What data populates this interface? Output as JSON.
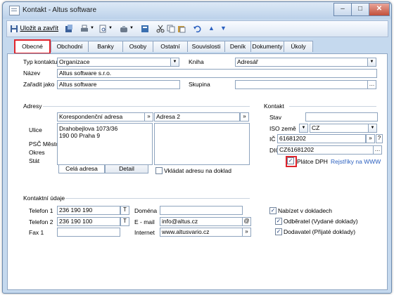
{
  "window": {
    "title": "Kontakt - Altus software",
    "min_glyph": "–",
    "max_glyph": "□",
    "close_glyph": "✕"
  },
  "toolbar": {
    "save_close_label": "Uložit a zavřít"
  },
  "tabs": [
    "Obecné",
    "Obchodní",
    "Banky",
    "Osoby",
    "Ostatní",
    "Souvislosti",
    "Deník",
    "Dokumenty",
    "Úkoly"
  ],
  "general": {
    "typ_kontaktu_label": "Typ kontaktu",
    "typ_kontaktu_value": "Organizace",
    "kniha_label": "Kniha",
    "kniha_value": "Adresář",
    "nazev_label": "Název",
    "nazev_value": "Altus software s.r.o.",
    "zaradit_label": "Zařadit jako",
    "zaradit_value": "Altus software",
    "skupina_label": "Skupina",
    "skupina_value": ""
  },
  "adresy": {
    "section_label": "Adresy",
    "addr1_type": "Korespondenční adresa",
    "addr2_type": "Adresa 2",
    "ulice_label": "Ulice",
    "psc_label": "PSČ Město",
    "okres_label": "Okres",
    "stat_label": "Stát",
    "address_line1": "Drahobejlova 1073/36",
    "address_line2": "190 00 Praha 9",
    "tab_full": "Celá adresa",
    "tab_detail": "Detail",
    "vkladat_label": "Vkládat adresu na doklad",
    "vkladat_checked": false
  },
  "kontakt": {
    "section_label": "Kontakt",
    "stav_label": "Stav",
    "stav_value": "",
    "iso_label": "ISO země",
    "iso_value": "CZ",
    "ic_label": "IČ",
    "ic_value": "61681202",
    "dic_label": "DIČ",
    "dic_value": "CZ61681202",
    "platce_label": "Plátce DPH",
    "platce_checked": true,
    "registry_link": "Rejstříky na WWW"
  },
  "kontaktni": {
    "section_label": "Kontaktní údaje",
    "tel1_label": "Telefon 1",
    "tel1_value": "236 190 190",
    "tel2_label": "Telefon 2",
    "tel2_value": "236 190 100",
    "fax_label": "Fax 1",
    "fax_value": "",
    "domena_label": "Doména",
    "domena_value": "",
    "email_label": "E - mail",
    "email_value": "info@altus.cz",
    "internet_label": "Internet",
    "internet_value": "www.altusvario.cz",
    "tel_btn": "T",
    "email_btn": "@",
    "web_btn": "»",
    "nabizet_label": "Nabízet v dokladech",
    "nabizet_checked": true,
    "odberatel_label": "Odběratel (Vydané doklady)",
    "odberatel_checked": true,
    "dodavatel_label": "Dodavatel (Přijaté doklady)",
    "dodavatel_checked": true
  },
  "colors": {
    "accent_red": "#e0242c",
    "link_blue": "#2a5fbf"
  }
}
